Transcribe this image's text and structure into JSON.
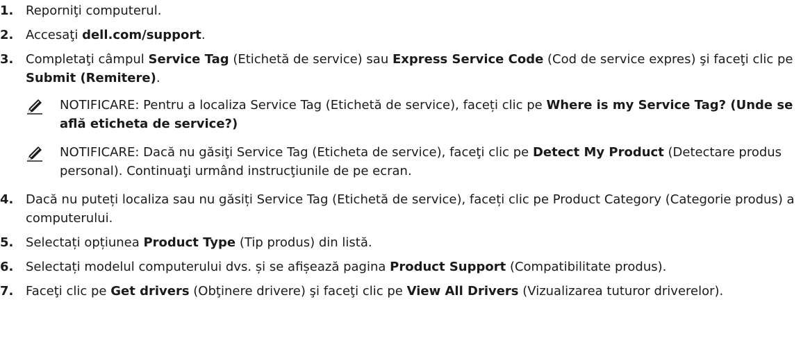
{
  "steps": [
    {
      "num": "1.",
      "segments": [
        {
          "t": "Reporniţi computerul."
        }
      ]
    },
    {
      "num": "2.",
      "segments": [
        {
          "t": "Accesaţi "
        },
        {
          "t": "dell.com/support",
          "b": true
        },
        {
          "t": "."
        }
      ]
    },
    {
      "num": "3.",
      "segments": [
        {
          "t": "Completaţi câmpul "
        },
        {
          "t": "Service Tag",
          "b": true
        },
        {
          "t": " (Etichetă de service) sau "
        },
        {
          "t": "Express Service Code",
          "b": true
        },
        {
          "t": " (Cod de service expres) şi faceţi clic pe "
        },
        {
          "t": "Submit (Remitere)",
          "b": true
        },
        {
          "t": "."
        }
      ]
    }
  ],
  "notes": [
    {
      "icon": "pencil-note-icon",
      "segments": [
        {
          "t": "NOTIFICARE:",
          "label": true
        },
        {
          "t": " Pentru a localiza Service Tag (Etichetă de service), faceți clic pe "
        },
        {
          "t": "Where is my Service Tag? (Unde se află eticheta de service?)",
          "b": true
        }
      ]
    },
    {
      "icon": "pencil-note-icon",
      "segments": [
        {
          "t": "NOTIFICARE:",
          "label": true
        },
        {
          "t": " Dacă nu găsiţi Service Tag (Eticheta de service), faceţi clic pe "
        },
        {
          "t": "Detect My Product",
          "b": true
        },
        {
          "t": " (Detectare produs personal). Continuaţi urmând instrucţiunile de pe ecran."
        }
      ]
    }
  ],
  "steps2": [
    {
      "num": "4.",
      "segments": [
        {
          "t": "Dacă nu puteți localiza sau nu găsiți Service Tag (Etichetă de service), faceți clic pe Product Category (Categorie produs) a computerului."
        }
      ]
    },
    {
      "num": "5.",
      "segments": [
        {
          "t": "Selectați opțiunea "
        },
        {
          "t": "Product Type",
          "b": true
        },
        {
          "t": " (Tip produs) din listă."
        }
      ]
    },
    {
      "num": "6.",
      "segments": [
        {
          "t": "Selectați modelul computerului dvs. și se afișează pagina "
        },
        {
          "t": "Product Support",
          "b": true
        },
        {
          "t": " (Compatibilitate produs)."
        }
      ]
    },
    {
      "num": "7.",
      "segments": [
        {
          "t": "Faceţi clic pe "
        },
        {
          "t": "Get drivers",
          "b": true
        },
        {
          "t": " (Obţinere drivere) şi faceţi clic pe "
        },
        {
          "t": "View All Drivers",
          "b": true
        },
        {
          "t": " (Vizualizarea tuturor driverelor)."
        }
      ]
    }
  ]
}
